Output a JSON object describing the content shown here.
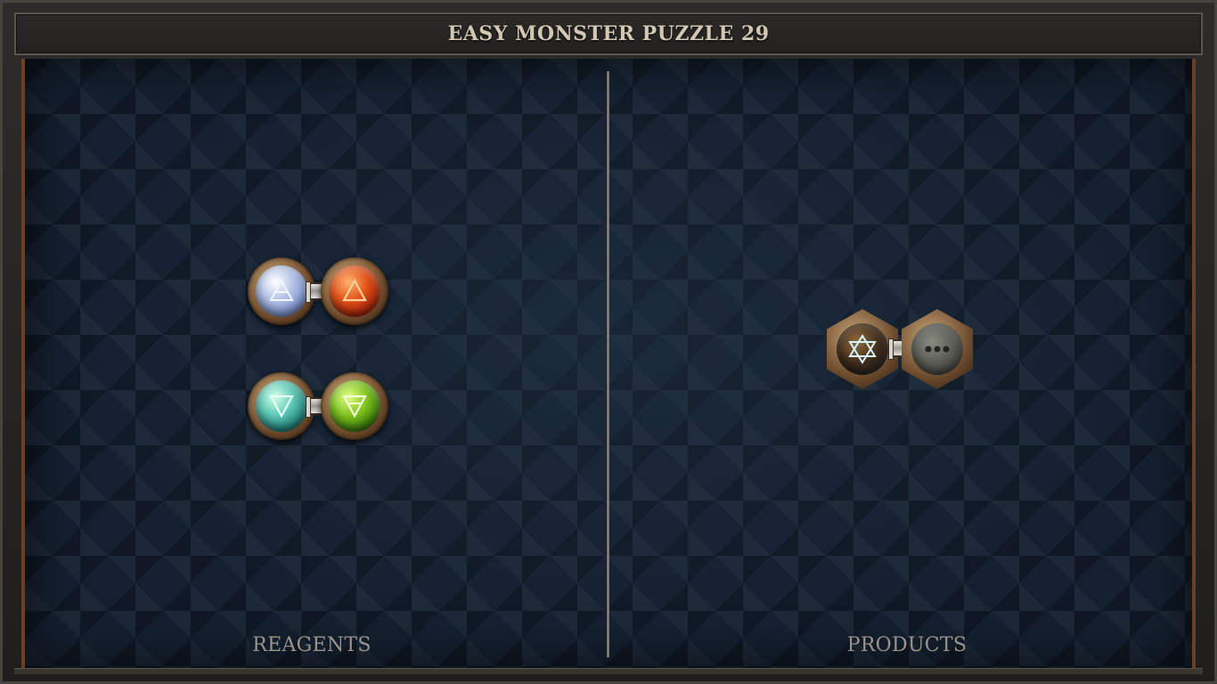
{
  "title": "EASY MONSTER PUZZLE 29",
  "panels": {
    "reagents_label": "REAGENTS",
    "products_label": "PRODUCTS"
  },
  "reagents": [
    {
      "left": "air",
      "right": "fire"
    },
    {
      "left": "water",
      "right": "earth"
    }
  ],
  "products": [
    {
      "left": "aether",
      "right": "unknown"
    }
  ],
  "colors": {
    "board": "#142030",
    "frame": "#2e2c2a",
    "title_text": "#d2c7b1",
    "label_text": "#9a948b",
    "trim": "#6b3f22"
  },
  "icons": {
    "air": "air-element-icon",
    "fire": "fire-element-icon",
    "water": "water-element-icon",
    "earth": "earth-element-icon",
    "aether": "hexagram-icon",
    "unknown": "ellipsis-icon"
  }
}
